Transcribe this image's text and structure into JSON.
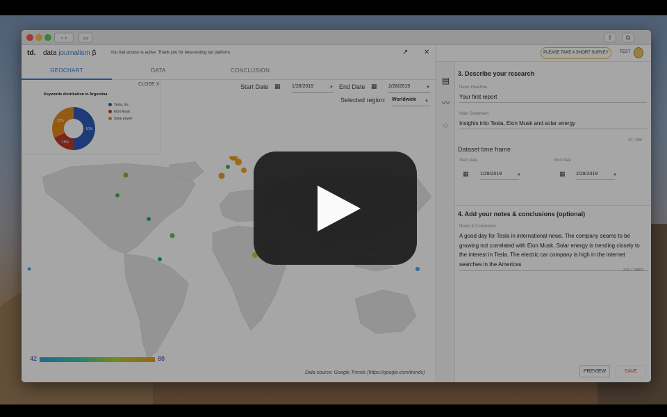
{
  "header": {
    "brand": "td.",
    "brand_word": "data",
    "brand_accent": "journalism",
    "brand_beta": "β",
    "trial_note": "You trial access is active. Thank you for beta-testing our platform.",
    "external_icon": "↗",
    "close_icon": "✕"
  },
  "tabs": [
    {
      "label": "GEOCHART"
    },
    {
      "label": "DATA"
    },
    {
      "label": "CONCLUSION"
    }
  ],
  "controls": {
    "start_label": "Start Date",
    "start_value": "1/28/2019",
    "end_label": "End Date",
    "end_value": "2/28/2019",
    "region_label": "Selected region:",
    "region_value": "Worldwide"
  },
  "donut": {
    "close_label": "CLOSE X",
    "title": "Keywords distribution in Argentina",
    "legend": [
      {
        "label": "Tesla, Inc.",
        "color": "#2f5bb7"
      },
      {
        "label": "Elon Musk",
        "color": "#c0392b"
      },
      {
        "label": "Solar power",
        "color": "#e38a1e"
      }
    ],
    "chart_data": {
      "type": "pie",
      "categories": [
        "Tesla, Inc.",
        "Elon Musk",
        "Solar power"
      ],
      "values": [
        50,
        18,
        32
      ],
      "slice_labels": [
        "50%",
        "18%",
        "32%"
      ]
    }
  },
  "map": {
    "scale_min": "42",
    "scale_max": "88",
    "source": "Data source: Google Trends (https://google.com/trends)"
  },
  "right": {
    "survey_label": "PLEASE TAKE A SHORT SURVEY",
    "test_label": "TEST",
    "section3_title": "3. Describe your research",
    "headline_label": "News Headline",
    "headline_value": "Your first report",
    "statement_label": "Main Statement",
    "statement_value": "Insights into Tesla, Elon Musk and solar energy",
    "statement_counter": "47 / 300",
    "timeframe_title": "Dataset time frame",
    "start_date_label": "Start date",
    "start_date_value": "1/28/2019",
    "end_date_label": "End date",
    "end_date_value": "2/28/2019",
    "section4_title": "4. Add your notes & conclusions (optional)",
    "notes_label": "Notes & Conclusion",
    "notes_value": "A good day for Tesla in international news. The company seams to be growing not correlated with Elon Musk. Solar energy is trending closely to the interest in Tesla. The electric car company is high in the internet searches in the Americas",
    "notes_counter": "239 / 10000",
    "preview_label": "PREVIEW",
    "save_label": "SAVE"
  },
  "colors": {
    "accent": "#2f7fd1",
    "save": "#d9534f",
    "survey_border": "#d9b46a"
  },
  "icons": {
    "rail": [
      "news-card-icon",
      "trend-line-icon",
      "donut-chart-icon"
    ],
    "calendar": "calendar-icon"
  }
}
